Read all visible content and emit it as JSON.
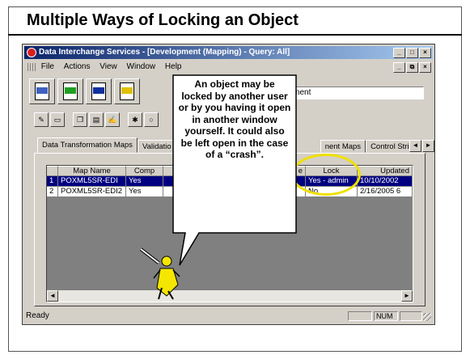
{
  "slide": {
    "title": "Multiple Ways of Locking an Object"
  },
  "window": {
    "title": "Data Interchange Services - [Development (Mapping)  -  Query: All]",
    "title_buttons": [
      "_",
      "□",
      "×"
    ],
    "mdi_buttons": [
      "_",
      "⧉",
      "×"
    ]
  },
  "menu": {
    "items": [
      "File",
      "Actions",
      "View",
      "Window",
      "Help"
    ]
  },
  "toolbar": {
    "connection_text": "opment"
  },
  "tabs": {
    "items": [
      {
        "label": "Data Transformation Maps",
        "active": true
      },
      {
        "label": "Validatio",
        "active": false
      },
      {
        "label": "nent Maps",
        "active": false
      },
      {
        "label": "Control Strings",
        "active": false
      }
    ],
    "arrows": [
      "◄",
      "►"
    ]
  },
  "grid": {
    "columns": [
      "",
      "Map Name",
      "Comp",
      "",
      "e",
      "Lock",
      "Updated"
    ],
    "rows": [
      {
        "num": "1",
        "map_name": "POXML5SR-EDI",
        "comp": "Yes",
        "lock": "Yes - admin",
        "updated": "10/10/2002",
        "selected": true
      },
      {
        "num": "2",
        "map_name": "POXML5SR-EDI2",
        "comp": "Yes",
        "lock": "No",
        "updated": "2/16/2005 6",
        "selected": false
      }
    ]
  },
  "status": {
    "text": "Ready",
    "num": "NUM"
  },
  "callout": {
    "text": "An object may be locked by another user or by you having it open in another window yourself.  It could also be left open in the case of a “crash”."
  },
  "colors": {
    "titlebar_start": "#0a246a",
    "titlebar_end": "#a6caf0",
    "selection": "#000080",
    "highlight_ring": "#f0e000",
    "figure": "#f5e600"
  }
}
